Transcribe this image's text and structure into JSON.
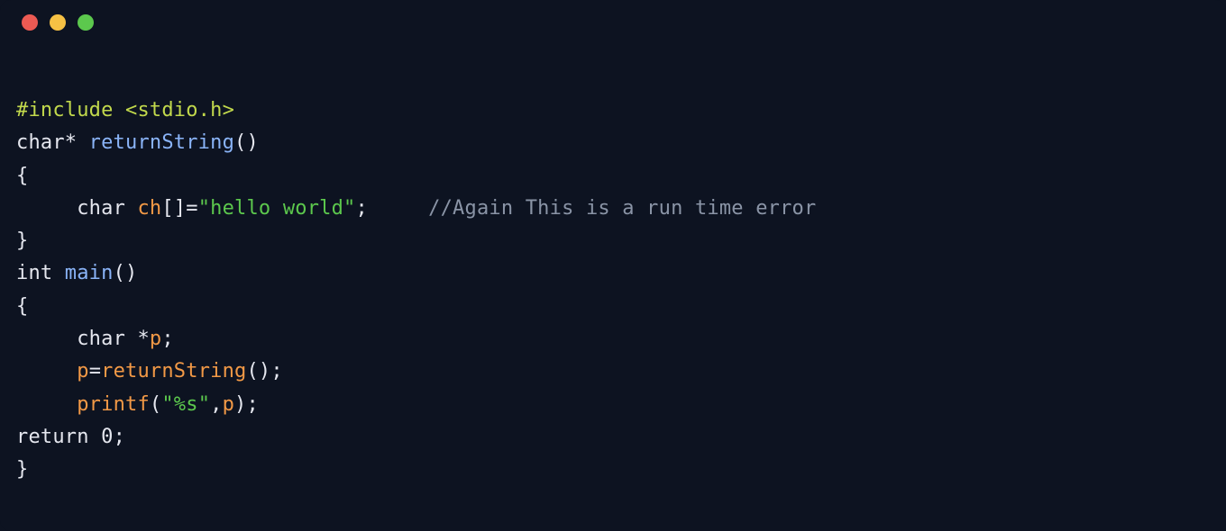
{
  "titlebar": {
    "buttons": {
      "close_color": "#ec5a53",
      "minimize_color": "#f6c144",
      "maximize_color": "#5cc84d"
    }
  },
  "code": {
    "line1_include": "#include <stdio.h>",
    "line2_char": "char",
    "line2_star": "* ",
    "line2_func": "returnString",
    "line2_parens": "()",
    "line3_brace": "{",
    "line4_indent": "     ",
    "line4_char": "char",
    "line4_space1": " ",
    "line4_var": "ch",
    "line4_brackets": "[]=",
    "line4_string": "\"hello world\"",
    "line4_semi": ";     ",
    "line4_comment": "//Again This is a run time error",
    "line5_brace": "}",
    "line6_int": "int",
    "line6_space": " ",
    "line6_main": "main",
    "line6_parens": "()",
    "line7_brace": "{",
    "line8_indent": "     ",
    "line8_char": "char",
    "line8_space": " ",
    "line8_starp": "*",
    "line8_p": "p",
    "line8_semi": ";",
    "line9_indent": "     ",
    "line9_p": "p",
    "line9_eq": "=",
    "line9_func": "returnString",
    "line9_parens": "();",
    "line10_indent": "     ",
    "line10_printf": "printf",
    "line10_open": "(",
    "line10_fmt": "\"%s\"",
    "line10_comma": ",",
    "line10_p": "p",
    "line10_close": ");",
    "line11_return": "return",
    "line11_space": " ",
    "line11_zero": "0",
    "line11_semi": ";",
    "line12_brace": "}"
  }
}
